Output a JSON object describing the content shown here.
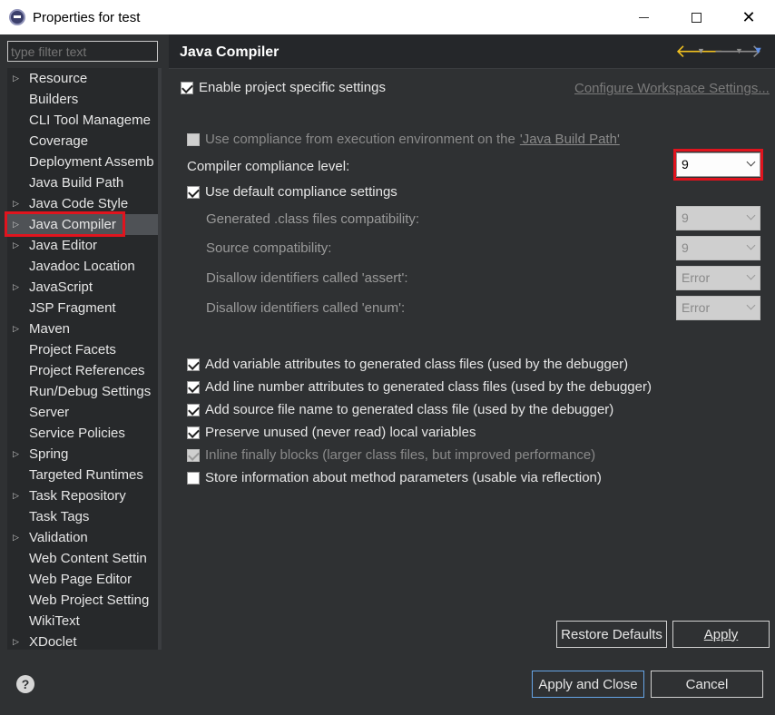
{
  "window": {
    "title": "Properties for test",
    "minimize": "–",
    "maximize": "☐",
    "close": "✕"
  },
  "sidebar": {
    "filter_placeholder": "type filter text",
    "items": [
      {
        "label": "Resource",
        "expandable": true
      },
      {
        "label": "Builders",
        "expandable": false
      },
      {
        "label": "CLI Tool Manageme",
        "expandable": false
      },
      {
        "label": "Coverage",
        "expandable": false
      },
      {
        "label": "Deployment Assemb",
        "expandable": false
      },
      {
        "label": "Java Build Path",
        "expandable": false
      },
      {
        "label": "Java Code Style",
        "expandable": true
      },
      {
        "label": "Java Compiler",
        "expandable": true,
        "selected": true
      },
      {
        "label": "Java Editor",
        "expandable": true
      },
      {
        "label": "Javadoc Location",
        "expandable": false
      },
      {
        "label": "JavaScript",
        "expandable": true
      },
      {
        "label": "JSP Fragment",
        "expandable": false
      },
      {
        "label": "Maven",
        "expandable": true
      },
      {
        "label": "Project Facets",
        "expandable": false
      },
      {
        "label": "Project References",
        "expandable": false
      },
      {
        "label": "Run/Debug Settings",
        "expandable": false
      },
      {
        "label": "Server",
        "expandable": false
      },
      {
        "label": "Service Policies",
        "expandable": false
      },
      {
        "label": "Spring",
        "expandable": true
      },
      {
        "label": "Targeted Runtimes",
        "expandable": false
      },
      {
        "label": "Task Repository",
        "expandable": true
      },
      {
        "label": "Task Tags",
        "expandable": false
      },
      {
        "label": "Validation",
        "expandable": true
      },
      {
        "label": "Web Content Settin",
        "expandable": false
      },
      {
        "label": "Web Page Editor",
        "expandable": false
      },
      {
        "label": "Web Project Setting",
        "expandable": false
      },
      {
        "label": "WikiText",
        "expandable": false
      },
      {
        "label": "XDoclet",
        "expandable": true
      }
    ]
  },
  "page": {
    "title": "Java Compiler",
    "enable_project_specific": {
      "label": "Enable project specific settings",
      "checked": true
    },
    "configure_workspace_link": "Configure Workspace Settings...",
    "use_compliance_from_env": {
      "label": "Use compliance from execution environment on the",
      "link": "'Java Build Path'",
      "checked": false,
      "enabled": false
    },
    "compliance_level": {
      "label": "Compiler compliance level:",
      "value": "9"
    },
    "use_default_compliance": {
      "label": "Use default compliance settings",
      "checked": true
    },
    "generated_class_compat": {
      "label": "Generated .class files compatibility:",
      "value": "9"
    },
    "source_compat": {
      "label": "Source compatibility:",
      "value": "9"
    },
    "disallow_assert": {
      "label": "Disallow identifiers called 'assert':",
      "value": "Error"
    },
    "disallow_enum": {
      "label": "Disallow identifiers called 'enum':",
      "value": "Error"
    },
    "options": [
      {
        "label": "Add variable attributes to generated class files (used by the debugger)",
        "checked": true,
        "enabled": true
      },
      {
        "label": "Add line number attributes to generated class files (used by the debugger)",
        "checked": true,
        "enabled": true
      },
      {
        "label": "Add source file name to generated class file (used by the debugger)",
        "checked": true,
        "enabled": true
      },
      {
        "label": "Preserve unused (never read) local variables",
        "checked": true,
        "enabled": true
      },
      {
        "label": "Inline finally blocks (larger class files, but improved performance)",
        "checked": true,
        "enabled": false
      },
      {
        "label": "Store information about method parameters (usable via reflection)",
        "checked": false,
        "enabled": true
      }
    ],
    "restore_defaults": "Restore Defaults",
    "apply": "Apply"
  },
  "footer": {
    "help": "?",
    "apply_and_close": "Apply and Close",
    "cancel": "Cancel"
  },
  "colors": {
    "highlight_red": "#e0141e",
    "nav_back": "#f0c020",
    "nav_menu": "#5e8fe8"
  }
}
